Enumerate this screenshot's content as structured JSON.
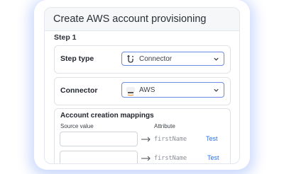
{
  "header": {
    "title": "Create AWS account provisioning"
  },
  "step": {
    "label": "Step 1"
  },
  "step_type": {
    "label": "Step type",
    "value": "Connector",
    "icon": "connector-icon"
  },
  "connector": {
    "label": "Connector",
    "value": "AWS",
    "icon": "aws-icon"
  },
  "mappings": {
    "title": "Account creation mappings",
    "col_source": "Source value",
    "col_attribute": "Attribute",
    "rows": [
      {
        "source": "",
        "attribute": "firstName",
        "action": "Test"
      },
      {
        "source": "",
        "attribute": "firstName",
        "action": "Test"
      }
    ]
  },
  "colors": {
    "accent": "#2f6fe4",
    "focus_border": "#6b8ce0",
    "glow": "#4678f0"
  }
}
